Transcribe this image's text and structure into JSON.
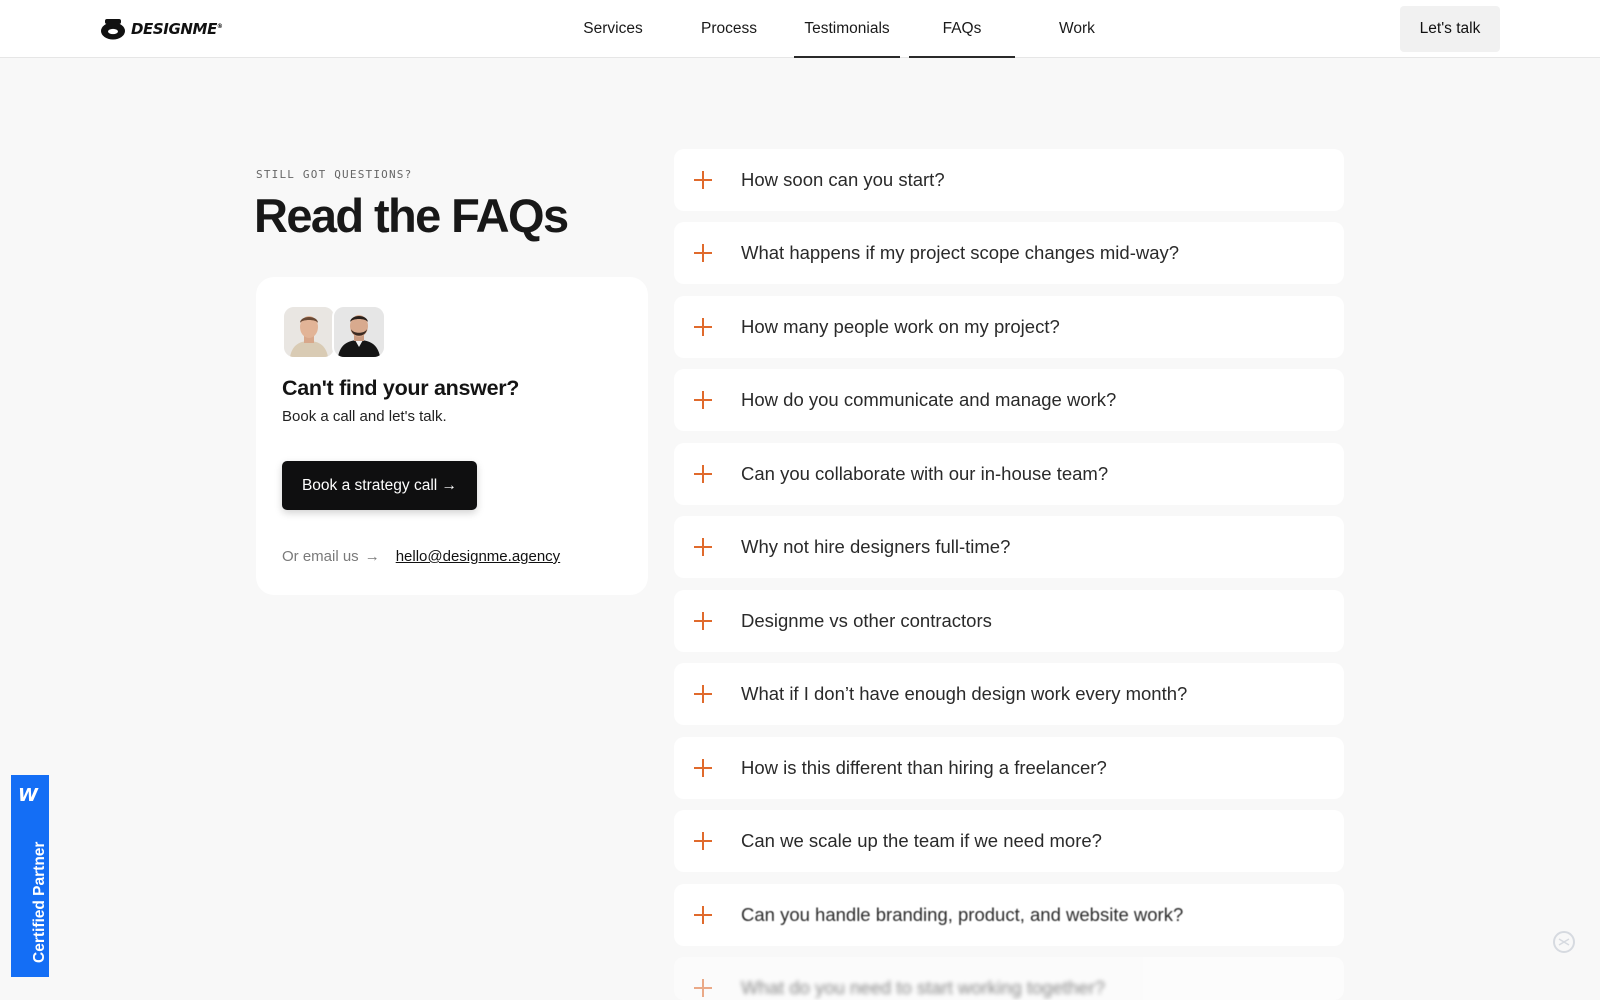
{
  "header": {
    "logo_text": "DESIGNME",
    "nav": [
      {
        "label": "Services"
      },
      {
        "label": "Process"
      },
      {
        "label": "Testimonials"
      },
      {
        "label": "FAQs"
      },
      {
        "label": "Work"
      }
    ],
    "cta_label": "Let's talk"
  },
  "intro": {
    "eyebrow": "STILL GOT QUESTIONS?",
    "title": "Read the FAQs"
  },
  "contact_card": {
    "title": "Can't find your answer?",
    "subtitle": "Book a call and let's talk.",
    "button_label": "Book a strategy call →",
    "email_prefix": "Or email us",
    "email_arrow": "→",
    "email": "hello@designme.agency"
  },
  "faqs": [
    {
      "question": "How soon can you start?"
    },
    {
      "question": "What happens if my project scope changes mid-way?"
    },
    {
      "question": "How many people work on my project?"
    },
    {
      "question": "How do you communicate and manage work?"
    },
    {
      "question": "Can you collaborate with our in-house team?"
    },
    {
      "question": "Why not hire designers full-time?"
    },
    {
      "question": "Designme vs other contractors"
    },
    {
      "question": "What if I don’t have enough design work every month?"
    },
    {
      "question": "How is this different than hiring a freelancer?"
    },
    {
      "question": "Can we scale up the team if we need more?"
    },
    {
      "question": "Can you handle branding, product, and website work?"
    },
    {
      "question": "What do you need to start working together?"
    }
  ],
  "badge": {
    "label": "Certified Partner",
    "mark": "W"
  },
  "colors": {
    "accent_plus": "#e06a2c",
    "badge_blue": "#146ef5",
    "page_bg": "#f8f8f8",
    "button_dark": "#0f0f10"
  }
}
